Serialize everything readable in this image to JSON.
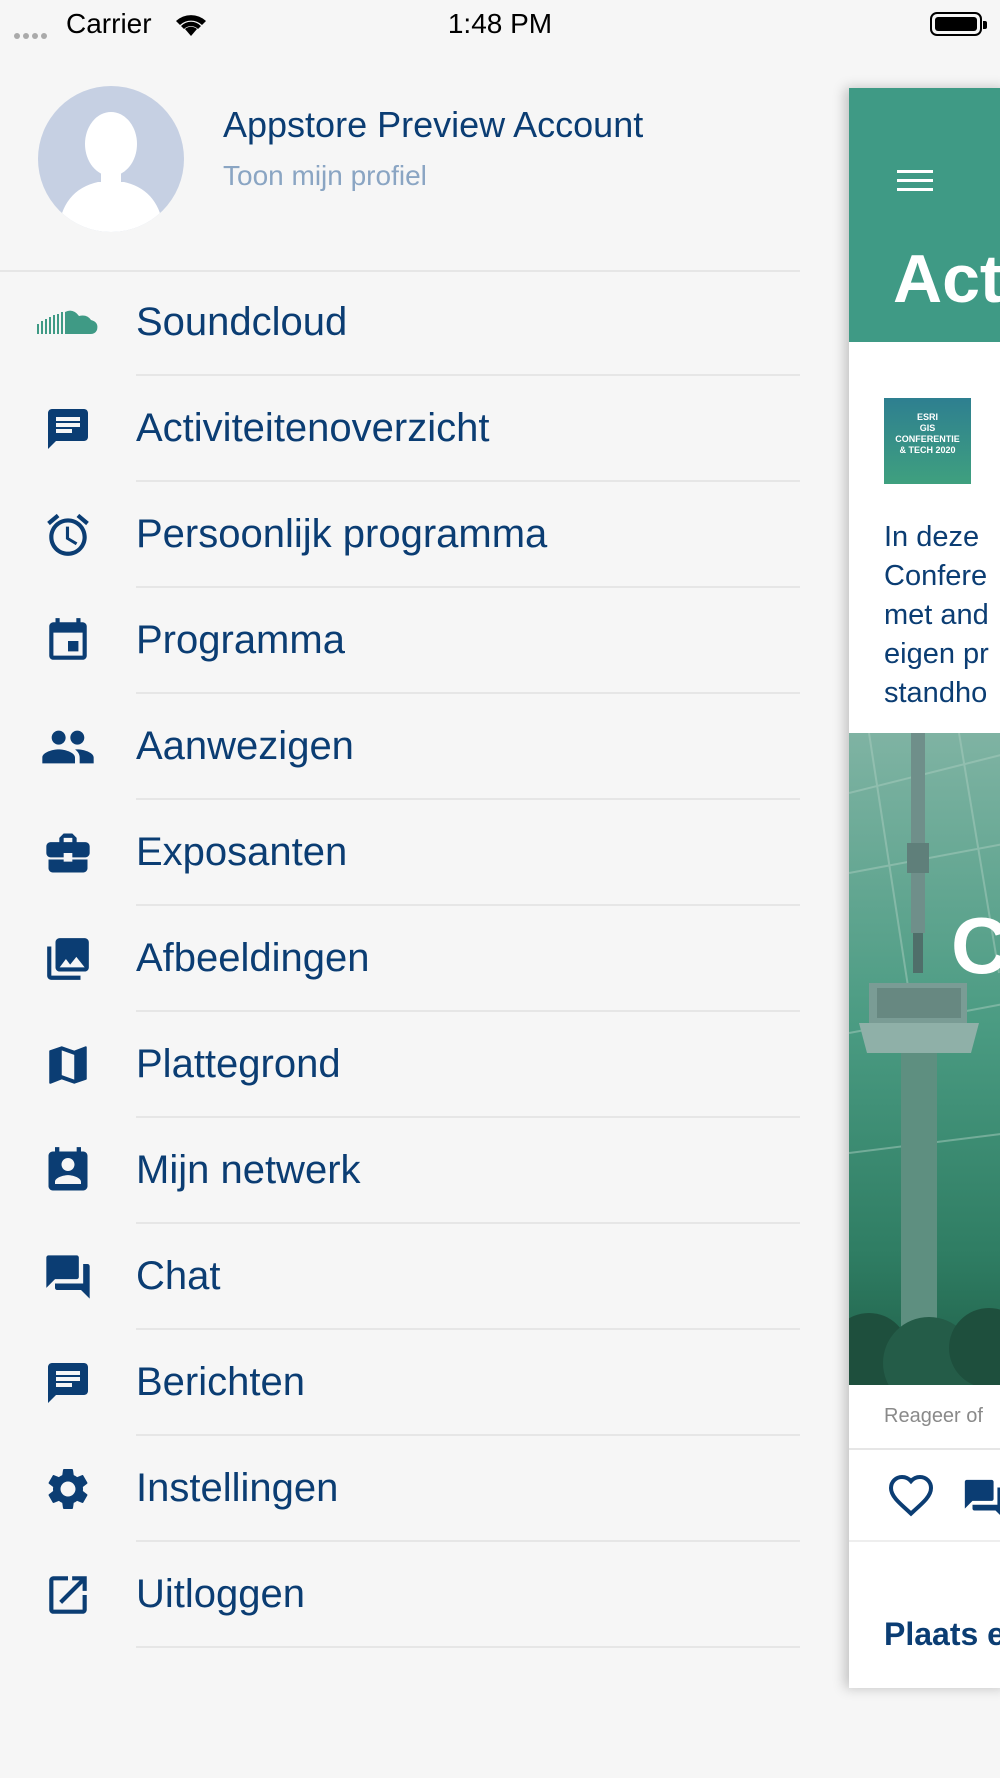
{
  "status_bar": {
    "carrier": "Carrier",
    "time": "1:48 PM"
  },
  "profile": {
    "name": "Appstore Preview Account",
    "link": "Toon mijn profiel"
  },
  "menu": {
    "items": [
      {
        "label": "Soundcloud",
        "icon": "soundcloud-icon"
      },
      {
        "label": "Activiteitenoverzicht",
        "icon": "message-icon"
      },
      {
        "label": "Persoonlijk programma",
        "icon": "alarm-icon"
      },
      {
        "label": "Programma",
        "icon": "calendar-icon"
      },
      {
        "label": "Aanwezigen",
        "icon": "people-icon"
      },
      {
        "label": "Exposanten",
        "icon": "briefcase-icon"
      },
      {
        "label": "Afbeeldingen",
        "icon": "images-icon"
      },
      {
        "label": "Plattegrond",
        "icon": "map-icon"
      },
      {
        "label": "Mijn netwerk",
        "icon": "contact-icon"
      },
      {
        "label": "Chat",
        "icon": "chat-icon"
      },
      {
        "label": "Berichten",
        "icon": "messages-icon"
      },
      {
        "label": "Instellingen",
        "icon": "gear-icon"
      },
      {
        "label": "Uitloggen",
        "icon": "logout-icon"
      }
    ]
  },
  "preview": {
    "title": "Act",
    "thumb_lines": [
      "ESRI",
      "GIS",
      "CONFERENTIE",
      "& TECH 2020"
    ],
    "text_lines": [
      "In deze",
      "Confere",
      "met and",
      "eigen pr",
      "standho"
    ],
    "reply": "Reageer of",
    "post_label": "Plaats e"
  },
  "colors": {
    "primary": "#0b3d73",
    "accent": "#3f9a85",
    "background": "#f6f6f6"
  }
}
